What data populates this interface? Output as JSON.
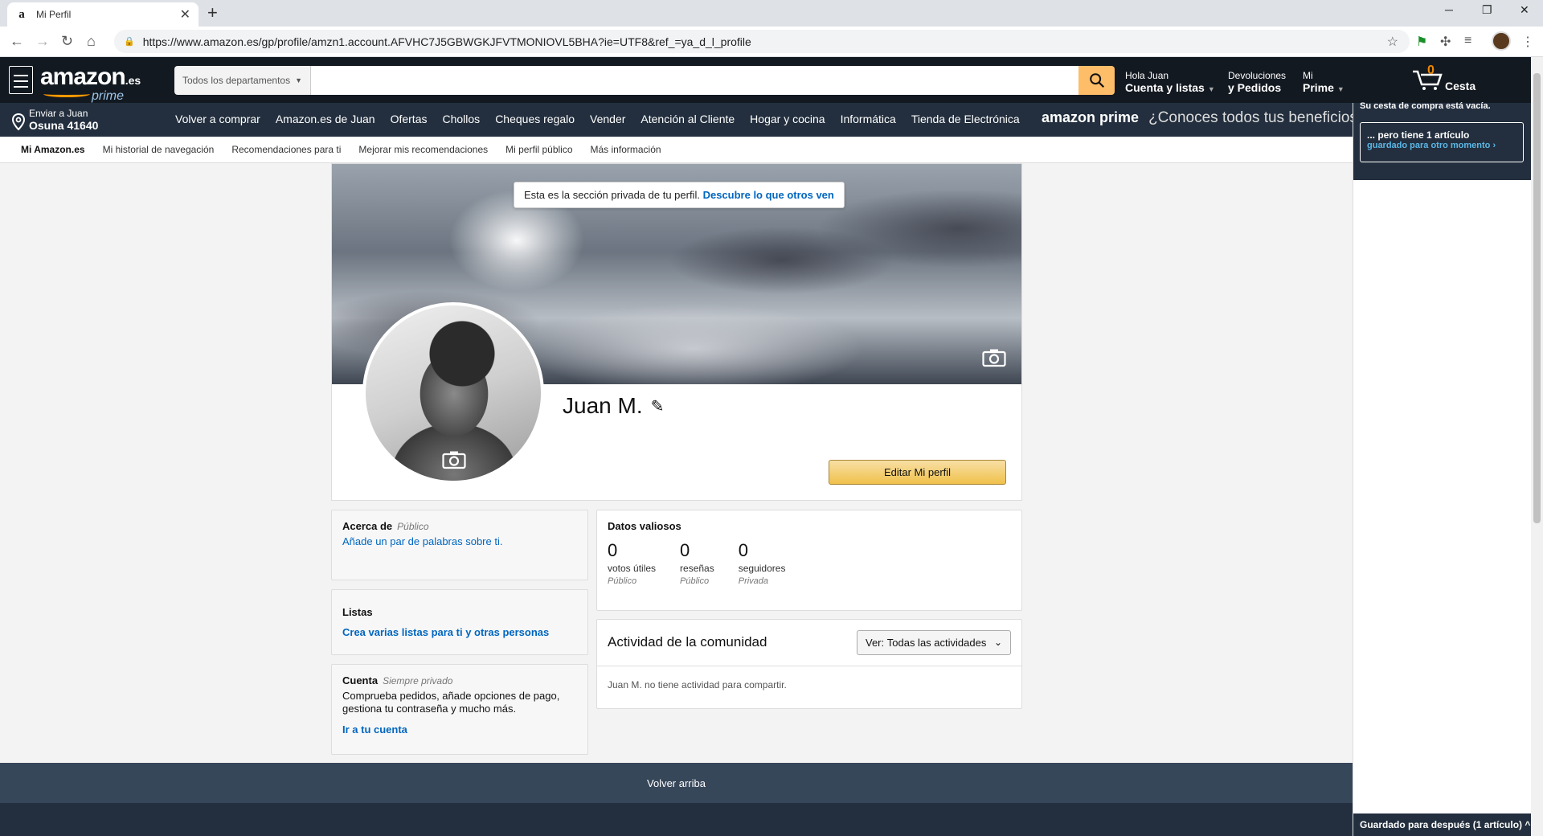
{
  "browser": {
    "tab_title": "Mi Perfil",
    "tab_favicon": "a",
    "url": "https://www.amazon.es/gp/profile/amzn1.account.AFVHC7J5GBWGKJFVTMONIOVL5BHA?ie=UTF8&ref_=ya_d_l_profile"
  },
  "header": {
    "logo_word": "amazon",
    "logo_tld": ".es",
    "logo_prime": "prime",
    "search_dept": "Todos los departamentos",
    "search_placeholder": "",
    "account_l1": "Hola Juan",
    "account_l2": "Cuenta y listas",
    "returns_l1": "Devoluciones",
    "returns_l2": "y Pedidos",
    "prime_l1": "Mi",
    "prime_l2": "Prime",
    "cart_count": "0",
    "cart_label": "Cesta"
  },
  "nav": {
    "deliver_l1": "Enviar a Juan",
    "deliver_l2": "Osuna 41640",
    "links": [
      "Volver a comprar",
      "Amazon.es de Juan",
      "Ofertas",
      "Chollos",
      "Cheques regalo",
      "Vender",
      "Atención al Cliente",
      "Hogar y cocina",
      "Informática",
      "Tienda de Electrónica"
    ],
    "prime_brand_a": "amazon",
    "prime_brand_b": "prime",
    "prime_tag": "¿Conoces todos tus beneficios?"
  },
  "subnav": {
    "items": [
      "Mi Amazon.es",
      "Mi historial de navegación",
      "Recomendaciones para ti",
      "Mejorar mis recomendaciones",
      "Mi perfil público",
      "Más información"
    ]
  },
  "sidecart": {
    "empty_text": "Su cesta de compra está vacía.",
    "saved_line1": "... pero tiene 1 artículo",
    "saved_line2": "guardado para otro momento ›",
    "footer": "Guardado para después (1 artículo)"
  },
  "profile": {
    "private_note": "Esta es la sección privada de tu perfil.",
    "private_link": "Descubre lo que otros ven",
    "name": "Juan M.",
    "edit_button": "Editar Mi perfil"
  },
  "about": {
    "title": "Acerca de",
    "visibility": "Público",
    "link": "Añade un par de palabras sobre ti."
  },
  "lists": {
    "title": "Listas",
    "link": "Crea varias listas para ti y otras personas"
  },
  "account": {
    "title": "Cuenta",
    "visibility": "Siempre privado",
    "text": "Comprueba pedidos, añade opciones de pago, gestiona tu contraseña y mucho más.",
    "link": "Ir a tu cuenta"
  },
  "insights": {
    "title": "Datos valiosos",
    "stats": [
      {
        "value": "0",
        "label": "votos útiles",
        "visibility": "Público"
      },
      {
        "value": "0",
        "label": "reseñas",
        "visibility": "Público"
      },
      {
        "value": "0",
        "label": "seguidores",
        "visibility": "Privada"
      }
    ]
  },
  "community": {
    "title": "Actividad de la comunidad",
    "filter_prefix": "Ver:",
    "filter_value": "Todas las actividades",
    "empty": "Juan M. no tiene actividad para compartir."
  },
  "footer": {
    "back_to_top": "Volver arriba"
  }
}
